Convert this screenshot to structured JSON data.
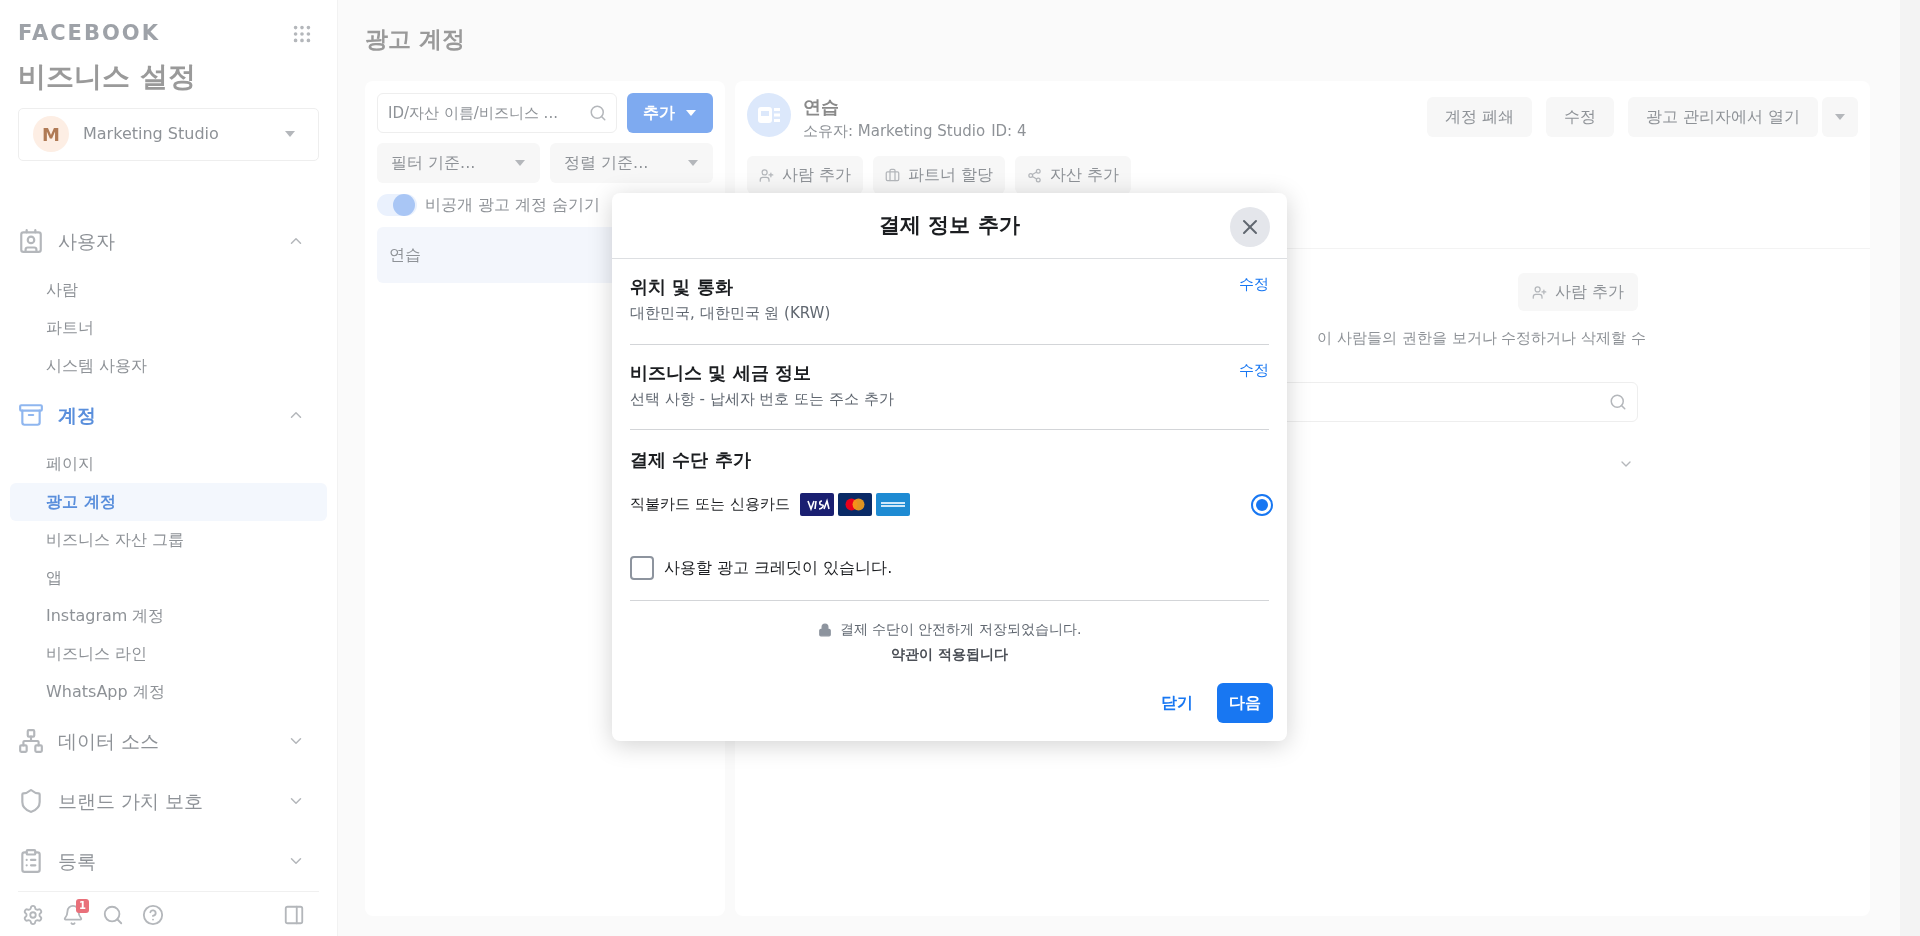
{
  "sidebar": {
    "brand": "FACEBOOK",
    "title": "비즈니스 설정",
    "business": {
      "initial": "M",
      "name": "Marketing Studio"
    },
    "sections": [
      {
        "label": "사용자",
        "expanded": true,
        "selected": false,
        "children": [
          {
            "label": "사람",
            "selected": false
          },
          {
            "label": "파트너",
            "selected": false
          },
          {
            "label": "시스템 사용자",
            "selected": false
          }
        ]
      },
      {
        "label": "계정",
        "expanded": true,
        "selected": true,
        "children": [
          {
            "label": "페이지",
            "selected": false
          },
          {
            "label": "광고 계정",
            "selected": true
          },
          {
            "label": "비즈니스 자산 그룹",
            "selected": false
          },
          {
            "label": "앱",
            "selected": false
          },
          {
            "label": "Instagram 계정",
            "selected": false
          },
          {
            "label": "비즈니스 라인",
            "selected": false
          },
          {
            "label": "WhatsApp 계정",
            "selected": false
          }
        ]
      },
      {
        "label": "데이터 소스",
        "expanded": false,
        "selected": false
      },
      {
        "label": "브랜드 가치 보호",
        "expanded": false,
        "selected": false
      },
      {
        "label": "등록",
        "expanded": false,
        "selected": false
      }
    ],
    "notification_count": "1"
  },
  "page": {
    "title": "광고 계정"
  },
  "list_panel": {
    "search": {
      "placeholder": "ID/자산 이름/비즈니스 ..."
    },
    "add_button": "추가",
    "filter": "필터 기준...",
    "sort": "정렬 기준...",
    "toggle": {
      "label": "비공개 광고 계정 숨기기",
      "on": true
    },
    "items": [
      {
        "label": "연습",
        "selected": true
      }
    ]
  },
  "detail": {
    "name": "연습",
    "owner": "소유자: Marketing Studio",
    "id": "ID: 4",
    "actions": [
      "계정 폐쇄",
      "수정",
      "광고 관리자에서 열기"
    ],
    "tabs": [
      "사람 추가",
      "파트너 할당",
      "자산 추가"
    ],
    "add_people": "사람 추가",
    "description": "이 사람들의 권한을 보거나 수정하거나 삭제할 수"
  },
  "dialog": {
    "title": "결제 정보 추가",
    "sections": [
      {
        "heading": "위치 및 통화",
        "value": "대한민국, 대한민국 원 (KRW)",
        "edit": "수정"
      },
      {
        "heading": "비즈니스 및 세금 정보",
        "value": "선택 사항 - 납세자 번호 또는 주소 추가",
        "edit": "수정"
      }
    ],
    "payment": {
      "heading": "결제 수단 추가",
      "option": {
        "label": "직불카드 또는 신용카드",
        "selected": true
      }
    },
    "credit": {
      "label": "사용할 광고 크레딧이 있습니다.",
      "checked": false
    },
    "secure": "결제 수단이 안전하게 저장되었습니다.",
    "terms": "약관이 적용됩니다",
    "close": "닫기",
    "next": "다음"
  }
}
